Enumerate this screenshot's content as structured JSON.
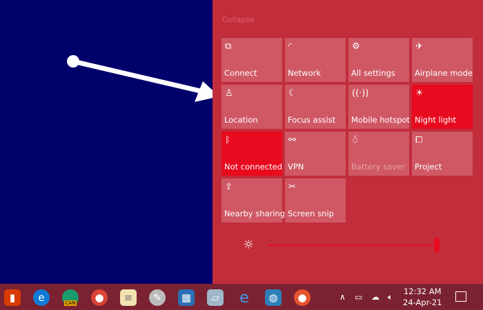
{
  "action_center": {
    "collapse_label": "Collapse",
    "tiles": [
      {
        "label": "Connect",
        "icon": "connect-icon",
        "state": "off"
      },
      {
        "label": "Network",
        "icon": "network-icon",
        "state": "off"
      },
      {
        "label": "All settings",
        "icon": "gear-icon",
        "state": "off"
      },
      {
        "label": "Airplane mode",
        "icon": "airplane-icon",
        "state": "off"
      },
      {
        "label": "Location",
        "icon": "location-icon",
        "state": "off"
      },
      {
        "label": "Focus assist",
        "icon": "moon-icon",
        "state": "off"
      },
      {
        "label": "Mobile hotspot",
        "icon": "hotspot-icon",
        "state": "off"
      },
      {
        "label": "Night light",
        "icon": "night-light-icon",
        "state": "on"
      },
      {
        "label": "Not connected",
        "icon": "bluetooth-icon",
        "state": "on"
      },
      {
        "label": "VPN",
        "icon": "vpn-icon",
        "state": "off"
      },
      {
        "label": "Battery saver",
        "icon": "battery-saver-icon",
        "state": "disabled"
      },
      {
        "label": "Project",
        "icon": "project-icon",
        "state": "off"
      },
      {
        "label": "Nearby sharing",
        "icon": "nearby-sharing-icon",
        "state": "off"
      },
      {
        "label": "Screen snip",
        "icon": "screen-snip-icon",
        "state": "off"
      }
    ],
    "brightness_percent": 100
  },
  "taskbar": {
    "time": "12:32 AM",
    "date": "24-Apr-21",
    "badge": "CAN"
  },
  "colors": {
    "accent": "#e80a1e",
    "panel": "#c22d3b",
    "tile": "#cf5864",
    "desktop": "#01016b",
    "taskbar": "#7b2232"
  }
}
